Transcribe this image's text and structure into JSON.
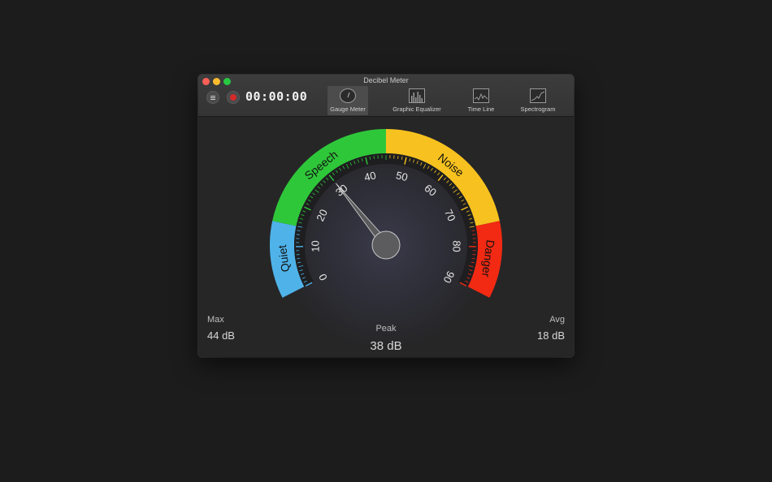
{
  "window": {
    "title": "Decibel Meter"
  },
  "toolbar": {
    "timer": "00:00:00",
    "tabs": [
      {
        "label": "Gauge Meter",
        "active": true,
        "icon": "gauge-icon"
      },
      {
        "label": "Graphic Equalizer",
        "active": false,
        "icon": "equalizer-icon"
      },
      {
        "label": "Time Line",
        "active": false,
        "icon": "timeline-icon"
      },
      {
        "label": "Spectrogram",
        "active": false,
        "icon": "spectrogram-icon"
      }
    ]
  },
  "gauge": {
    "min": 0,
    "max": 90,
    "value": 30,
    "ticks": [
      "0",
      "10",
      "20",
      "30",
      "40",
      "50",
      "60",
      "70",
      "80",
      "90"
    ],
    "zones": [
      {
        "label": "Quiet",
        "from": 0,
        "to": 15,
        "color": "#4fb3ea"
      },
      {
        "label": "Speech",
        "from": 15,
        "to": 45,
        "color": "#2fc73a"
      },
      {
        "label": "Noise",
        "from": 45,
        "to": 75,
        "color": "#f7c21f"
      },
      {
        "label": "Danger",
        "from": 75,
        "to": 90,
        "color": "#f22a13"
      }
    ]
  },
  "stats": {
    "max_label": "Max",
    "max_value": "44 dB",
    "peak_label": "Peak",
    "peak_value": "38 dB",
    "avg_label": "Avg",
    "avg_value": "18 dB"
  }
}
